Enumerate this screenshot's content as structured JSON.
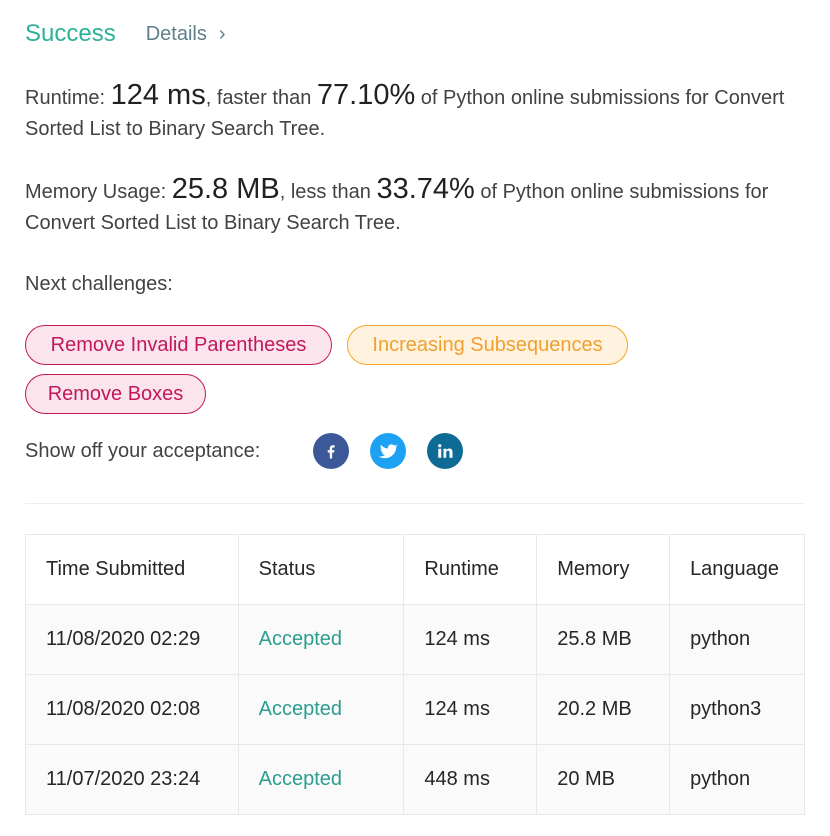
{
  "result": {
    "title": "Success",
    "details_label": "Details",
    "details_chevron": "›"
  },
  "runtime": {
    "label": "Runtime: ",
    "value": "124 ms",
    "comparison": ", faster than ",
    "percent": "77.10%",
    "suffix": " of Python online submissions for Convert Sorted List to Binary Search Tree."
  },
  "memory": {
    "label": "Memory Usage: ",
    "value": "25.8 MB",
    "comparison": ", less than ",
    "percent": "33.74%",
    "suffix": " of Python online submissions for Convert Sorted List to Binary Search Tree."
  },
  "next_challenges": {
    "label": "Next challenges:",
    "items": [
      {
        "label": "Remove Invalid Parentheses",
        "difficulty": "hard"
      },
      {
        "label": "Increasing Subsequences",
        "difficulty": "medium"
      },
      {
        "label": "Remove Boxes",
        "difficulty": "hard"
      }
    ]
  },
  "share": {
    "label": "Show off your acceptance:",
    "buttons": [
      {
        "icon": "facebook-icon",
        "color": "#3b5998"
      },
      {
        "icon": "twitter-icon",
        "color": "#1da1f2"
      },
      {
        "icon": "linkedin-icon",
        "color": "#0e6b95"
      }
    ]
  },
  "table": {
    "headers": [
      "Time Submitted",
      "Status",
      "Runtime",
      "Memory",
      "Language"
    ],
    "rows": [
      {
        "time": "11/08/2020 02:29",
        "status": "Accepted",
        "runtime": "124 ms",
        "memory": "25.8 MB",
        "language": "python"
      },
      {
        "time": "11/08/2020 02:08",
        "status": "Accepted",
        "runtime": "124 ms",
        "memory": "20.2 MB",
        "language": "python3"
      },
      {
        "time": "11/07/2020 23:24",
        "status": "Accepted",
        "runtime": "448 ms",
        "memory": "20 MB",
        "language": "python"
      }
    ]
  },
  "colors": {
    "success": "#2db09a",
    "accepted": "#2a9d8f",
    "hard": "#c2185b",
    "medium": "#f0a030"
  }
}
